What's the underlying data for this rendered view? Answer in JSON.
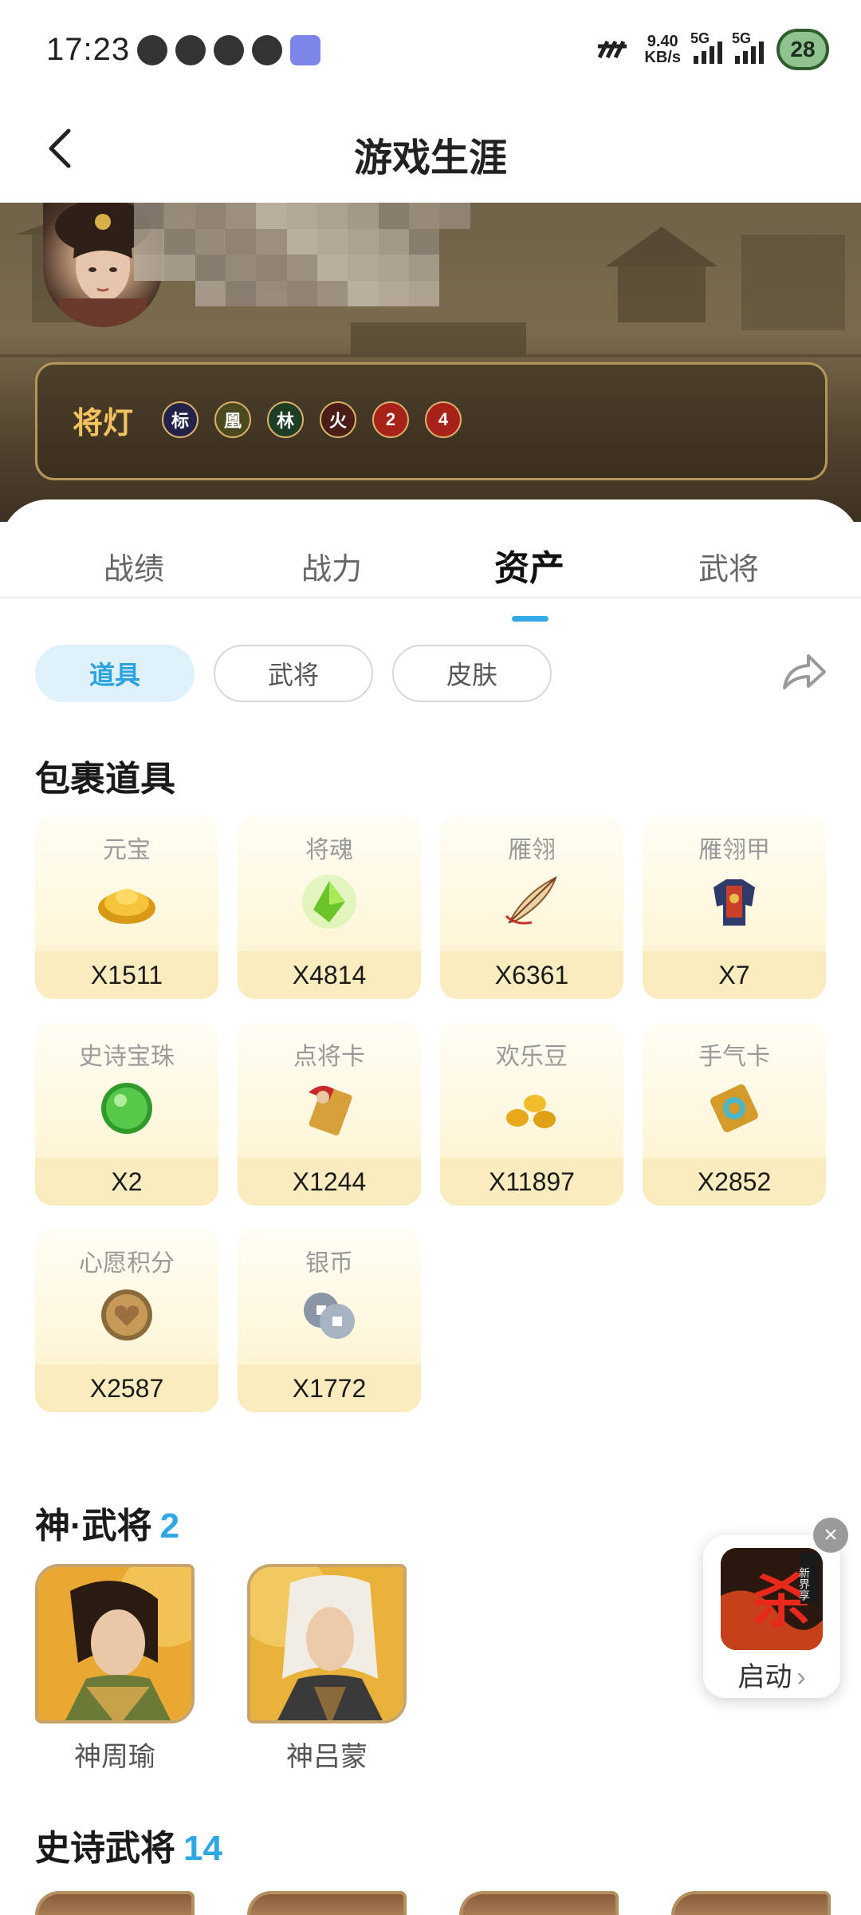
{
  "status_bar": {
    "time": "17:23",
    "net_speed_value": "9.40",
    "net_speed_unit": "KB/s",
    "sim1_label": "5G",
    "sim2_label": "5G",
    "battery": "28",
    "app_icons": [
      "wechat-icon",
      "tiktok-icon",
      "play-icon",
      "quark-icon",
      "app-icon"
    ]
  },
  "header": {
    "title": "游戏生涯"
  },
  "profile": {
    "lamp_title": "将灯",
    "badges": [
      {
        "text": "标",
        "color": "#23234a"
      },
      {
        "text": "凰",
        "color": "#4a4a1e"
      },
      {
        "text": "林",
        "color": "#1d3d25"
      },
      {
        "text": "火",
        "color": "#4a1d16"
      },
      {
        "text": "2",
        "color": "#a8221a"
      },
      {
        "text": "4",
        "color": "#a8221a"
      }
    ]
  },
  "tabs": [
    {
      "label": "战绩",
      "active": false
    },
    {
      "label": "战力",
      "active": false
    },
    {
      "label": "资产",
      "active": true
    },
    {
      "label": "武将",
      "active": false
    }
  ],
  "filters": [
    {
      "label": "道具",
      "active": true
    },
    {
      "label": "武将",
      "active": false
    },
    {
      "label": "皮肤",
      "active": false
    }
  ],
  "items_section": {
    "title": "包裹道具",
    "items": [
      {
        "name": "元宝",
        "count": "X1511",
        "icon": "gold-ingot-icon"
      },
      {
        "name": "将魂",
        "count": "X4814",
        "icon": "green-crystal-icon"
      },
      {
        "name": "雁翎",
        "count": "X6361",
        "icon": "feather-icon"
      },
      {
        "name": "雁翎甲",
        "count": "X7",
        "icon": "armor-icon"
      },
      {
        "name": "史诗宝珠",
        "count": "X2",
        "icon": "green-orb-icon"
      },
      {
        "name": "点将卡",
        "count": "X1244",
        "icon": "general-card-icon"
      },
      {
        "name": "欢乐豆",
        "count": "X11897",
        "icon": "beans-icon"
      },
      {
        "name": "手气卡",
        "count": "X2852",
        "icon": "luck-card-icon"
      },
      {
        "name": "心愿积分",
        "count": "X2587",
        "icon": "wish-coin-icon"
      },
      {
        "name": "银币",
        "count": "X1772",
        "icon": "silver-coin-icon"
      }
    ]
  },
  "god_generals": {
    "title": "神·武将",
    "count": "2",
    "heroes": [
      {
        "name": "神周瑜"
      },
      {
        "name": "神吕蒙"
      }
    ]
  },
  "epic_generals": {
    "title": "史诗武将",
    "count": "14"
  },
  "float_launcher": {
    "label": "启动",
    "close": "×",
    "logo_char": "杀",
    "logo_badge": "新界享"
  }
}
